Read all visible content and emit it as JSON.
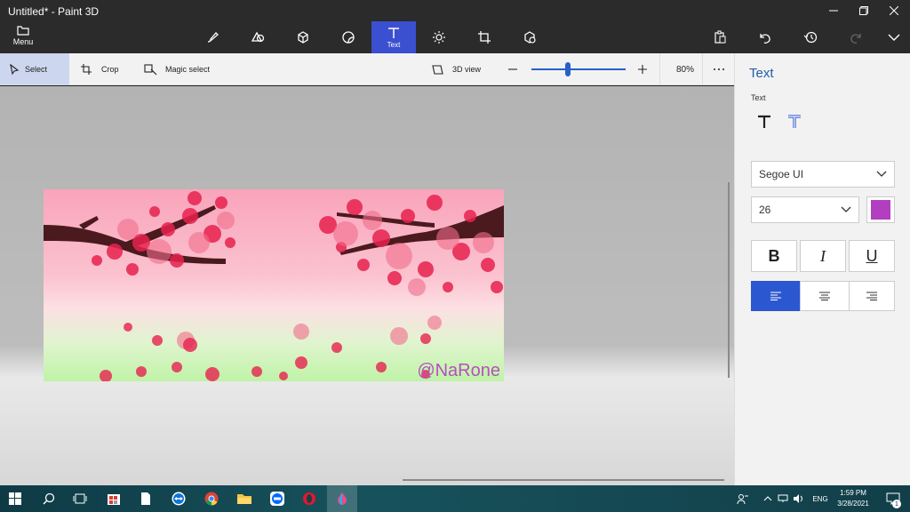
{
  "window": {
    "title": "Untitled* - Paint 3D"
  },
  "ribbon": {
    "menu_label": "Menu",
    "tools": [
      {
        "name": "brushes"
      },
      {
        "name": "2d-shapes"
      },
      {
        "name": "3d-shapes"
      },
      {
        "name": "stickers"
      },
      {
        "name": "text",
        "label": "Text",
        "active": true
      },
      {
        "name": "effects"
      },
      {
        "name": "canvas"
      },
      {
        "name": "3d-library"
      }
    ]
  },
  "toolbar": {
    "select_label": "Select",
    "crop_label": "Crop",
    "magic_select_label": "Magic select",
    "view3d_label": "3D view",
    "zoom_level": "80%",
    "zoom_fraction": 0.39
  },
  "canvas": {
    "watermark": "@NaRone"
  },
  "panel": {
    "title": "Text",
    "subtitle": "Text",
    "font": "Segoe UI",
    "size": "26",
    "color": "#b23fc0",
    "bold_label": "B",
    "italic_label": "I",
    "underline_label": "U"
  },
  "taskbar": {
    "lang": "ENG",
    "time": "1:59 PM",
    "date": "3/28/2021",
    "notif_count": "1"
  }
}
